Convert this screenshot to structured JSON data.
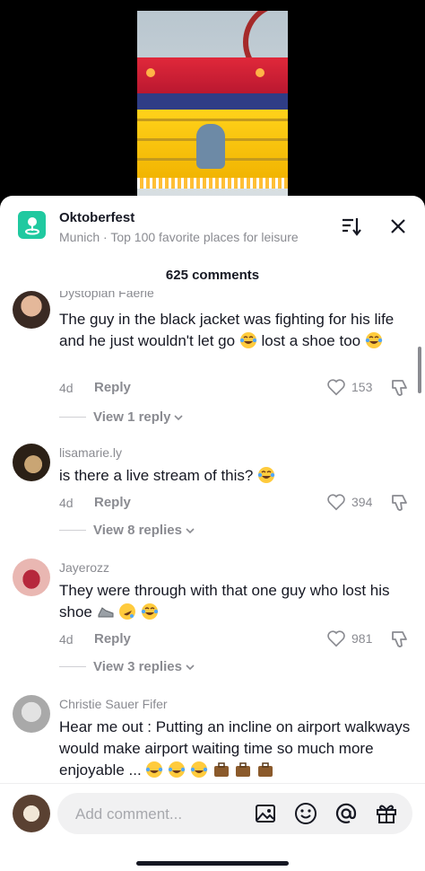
{
  "place": {
    "title": "Oktoberfest",
    "subtitle": "Munich · Top 100 favorite places for leisure",
    "icon": "location-pin-icon",
    "icon_color": "#20c9a0"
  },
  "comments_header": "625 comments",
  "comments": [
    {
      "username": "Dystopian Faerie",
      "text": "The guy in the black jacket was fighting for his life and he just wouldn't let go",
      "text_tail": "lost a shoe too",
      "age": "4d",
      "reply_label": "Reply",
      "likes": "153",
      "view_replies": "View 1 reply"
    },
    {
      "username": "lisamarie.ly",
      "text": "is there a live stream of this?",
      "age": "4d",
      "reply_label": "Reply",
      "likes": "394",
      "view_replies": "View 8 replies"
    },
    {
      "username": "Jayerozz",
      "text": "They were through with that one guy who lost his shoe",
      "age": "4d",
      "reply_label": "Reply",
      "likes": "981",
      "view_replies": "View 3 replies"
    },
    {
      "username": "Christie Sauer Fifer",
      "text": "Hear me out : Putting an incline on airport walkways would make airport waiting time so much more enjoyable ..."
    }
  ],
  "input": {
    "placeholder": "Add comment..."
  },
  "icons": {
    "sort": "sort-icon",
    "close": "close-icon",
    "like": "heart-icon",
    "dislike": "thumbs-down-icon",
    "image": "image-icon",
    "emoji": "emoji-icon",
    "mention": "at-mention-icon",
    "gift": "gift-icon"
  }
}
